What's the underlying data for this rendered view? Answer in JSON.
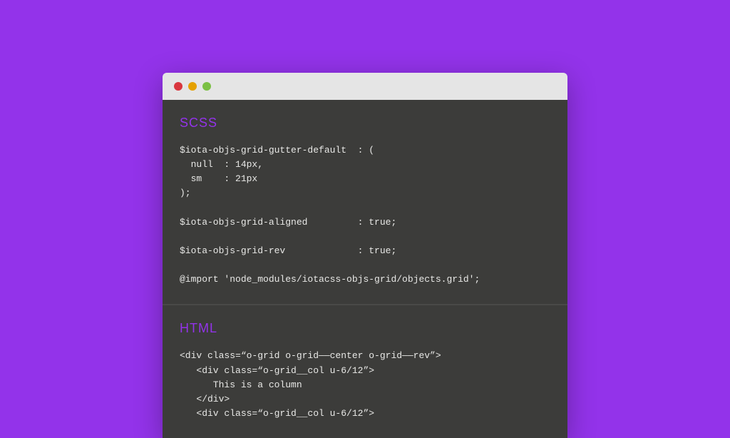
{
  "sections": {
    "scss": {
      "title": "SCSS",
      "code": "$iota-objs-grid-gutter-default  : (\n  null  : 14px,\n  sm    : 21px\n);\n\n$iota-objs-grid-aligned         : true;\n\n$iota-objs-grid-rev             : true;\n\n@import 'node_modules/iotacss-objs-grid/objects.grid';"
    },
    "html": {
      "title": "HTML",
      "code": "<div class=“o-grid o-grid——center o-grid——rev”>\n   <div class=“o-grid__col u-6/12”>\n      This is a column\n   </div>\n   <div class=“o-grid__col u-6/12”>"
    }
  }
}
